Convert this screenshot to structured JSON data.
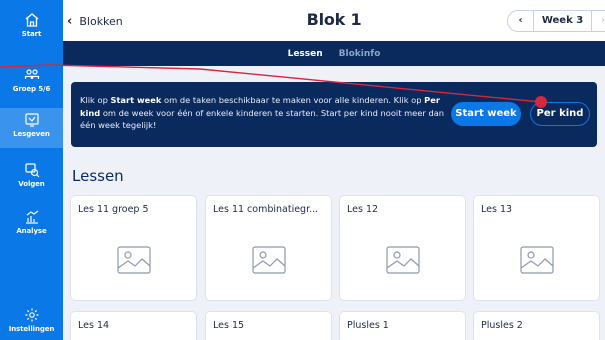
{
  "sidebar": {
    "items": [
      {
        "label": "Start",
        "icon": "home-icon"
      },
      {
        "label": "Groep 5/6",
        "icon": "group-icon"
      },
      {
        "label": "Lesgeven",
        "icon": "lesson-icon"
      },
      {
        "label": "Volgen",
        "icon": "follow-icon"
      },
      {
        "label": "Analyse",
        "icon": "analysis-icon"
      },
      {
        "label": "Instellingen",
        "icon": "gear-icon"
      }
    ],
    "active": "Lesgeven"
  },
  "header": {
    "back_label": "Blokken",
    "title": "Blok 1",
    "week_label": "Week 3"
  },
  "tabs": [
    {
      "label": "Lessen",
      "active": true
    },
    {
      "label": "Blokinfo",
      "active": false
    }
  ],
  "banner": {
    "t1": "Klik op ",
    "b1": "Start week",
    "t2": " om de taken beschikbaar te maken voor alle kinderen. Klik op ",
    "b2": "Per kind",
    "t3": " om de week voor één of enkele kinderen te starten. Start per kind nooit meer dan één week tegelijk!",
    "start_week_button": "Start week",
    "per_kind_button": "Per kind"
  },
  "section_title": "Lessen",
  "cards": [
    {
      "title": "Les 11 groep 5"
    },
    {
      "title": "Les 11 combinatiegr..."
    },
    {
      "title": "Les 12"
    },
    {
      "title": "Les 13"
    },
    {
      "title": "Les 14"
    },
    {
      "title": "Les 15"
    },
    {
      "title": "Plusles 1"
    },
    {
      "title": "Plusles 2"
    }
  ],
  "colors": {
    "sidebar": "#0a78e6",
    "navy": "#0a2a5e",
    "accent": "#0a78e6",
    "annotation": "#d7263d",
    "background": "#eef2f8"
  }
}
